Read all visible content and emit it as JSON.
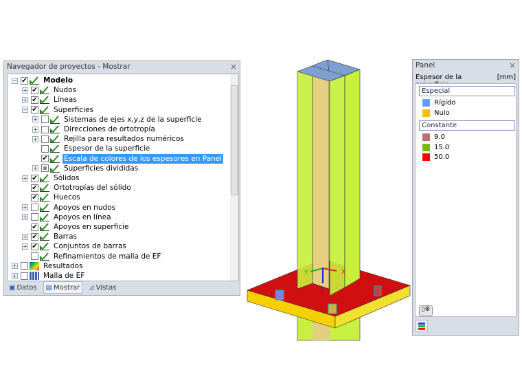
{
  "navigator": {
    "title": "Navegador de proyectos - Mostrar",
    "close": "×",
    "items": [
      {
        "label": "Modelo",
        "level": 0,
        "exp": "-",
        "check": "on",
        "bold": true
      },
      {
        "label": "Nudos",
        "level": 1,
        "exp": "+",
        "check": "on"
      },
      {
        "label": "Líneas",
        "level": 1,
        "exp": "+",
        "check": "on"
      },
      {
        "label": "Superficies",
        "level": 1,
        "exp": "-",
        "check": "on"
      },
      {
        "label": "Sistemas de ejes x,y,z de la superficie",
        "level": 2,
        "exp": "+",
        "check": "off"
      },
      {
        "label": "Direcciones de ortotropía",
        "level": 2,
        "exp": "+",
        "check": "off"
      },
      {
        "label": "Rejilla para resultados numéricos",
        "level": 2,
        "exp": "+",
        "check": "off"
      },
      {
        "label": "Espesor de la superficie",
        "level": 2,
        "exp": "",
        "check": "off"
      },
      {
        "label": "Escala de colores de los espesores en Panel",
        "level": 2,
        "exp": "",
        "check": "on",
        "selected": true
      },
      {
        "label": "Superficies divididas",
        "level": 2,
        "exp": "+",
        "check": "part"
      },
      {
        "label": "Sólidos",
        "level": 1,
        "exp": "+",
        "check": "on"
      },
      {
        "label": "Ortotropías del sólido",
        "level": 1,
        "exp": "",
        "check": "on"
      },
      {
        "label": "Huecos",
        "level": 1,
        "exp": "",
        "check": "on"
      },
      {
        "label": "Apoyos en nudos",
        "level": 1,
        "exp": "+",
        "check": "off"
      },
      {
        "label": "Apoyos en línea",
        "level": 1,
        "exp": "+",
        "check": "off"
      },
      {
        "label": "Apoyos en superficie",
        "level": 1,
        "exp": "",
        "check": "on"
      },
      {
        "label": "Barras",
        "level": 1,
        "exp": "+",
        "check": "on"
      },
      {
        "label": "Conjuntos de barras",
        "level": 1,
        "exp": "+",
        "check": "on"
      },
      {
        "label": "Refinamientos de malla de EF",
        "level": 1,
        "exp": "",
        "check": "off"
      },
      {
        "label": "Resultados",
        "level": 0,
        "exp": "+",
        "check": "off",
        "icon": "results"
      },
      {
        "label": "Malla de EF",
        "level": 0,
        "exp": "+",
        "check": "off",
        "icon": "mesh"
      }
    ],
    "tabs": [
      {
        "label": "Datos"
      },
      {
        "label": "Mostrar",
        "active": true
      },
      {
        "label": "Vistas"
      }
    ]
  },
  "panel": {
    "title": "Panel",
    "close": "×",
    "header": "Espesor de la superficie",
    "unit": "[mm]",
    "groups": [
      {
        "label": "Especial",
        "items": [
          {
            "label": "Rígido",
            "color": "#6699ff"
          },
          {
            "label": "Nulo",
            "color": "#f5c000"
          }
        ]
      },
      {
        "label": "Constante",
        "items": [
          {
            "label": "9.0",
            "color": "#b87070"
          },
          {
            "label": "15.0",
            "color": "#78b800"
          },
          {
            "label": "50.0",
            "color": "#ff0000"
          }
        ]
      }
    ]
  },
  "viewport": {
    "axes": {
      "x": "X",
      "y": "Y",
      "z": "Z"
    }
  }
}
